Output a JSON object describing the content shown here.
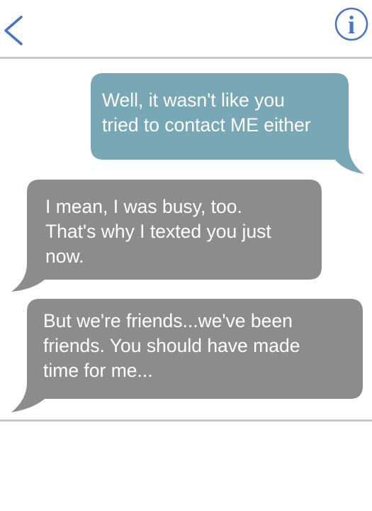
{
  "header": {
    "back_icon": "chevron-left-icon",
    "info_icon": "info-circle-icon",
    "info_glyph": "i",
    "accent_color": "#4a72c9"
  },
  "messages": [
    {
      "direction": "sent",
      "text": "Well, it wasn't like you\ntried to contact ME either",
      "color": "#78a8b5"
    },
    {
      "direction": "received",
      "text": "I mean, I was busy, too.\nThat's why I texted you just\nnow.",
      "color": "#8c8c8c"
    },
    {
      "direction": "received",
      "text": "But we're friends...we've been\nfriends. You should have made\ntime for me...",
      "color": "#8c8c8c"
    }
  ]
}
